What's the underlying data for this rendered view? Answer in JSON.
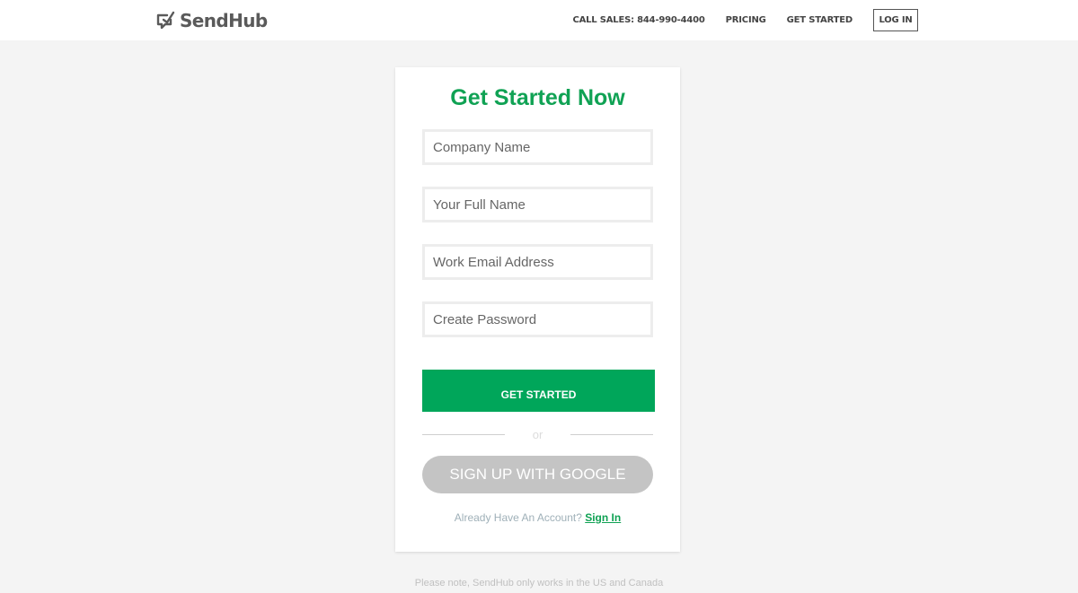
{
  "brand": {
    "name": "SendHub",
    "logo_icon": "chat-bubble-check-icon",
    "text_color": "#5a5a5a"
  },
  "nav": {
    "call_sales": "CALL SALES: 844-990-4400",
    "pricing": "PRICING",
    "get_started": "GET STARTED",
    "login": "LOG IN"
  },
  "signup": {
    "title": "Get Started Now",
    "company_placeholder": "Company Name",
    "name_placeholder": "Your Full Name",
    "email_placeholder": "Work Email Address",
    "password_placeholder": "Create Password",
    "submit_label": "GET STARTED",
    "divider_text": "or",
    "google_label": "SIGN UP WITH GOOGLE",
    "account_prompt": "Already Have An Account?",
    "signin_link": "Sign In"
  },
  "footer": {
    "note": "Please note, SendHub only works in the US and Canada"
  },
  "colors": {
    "accent_green": "#00a65a",
    "title_green": "#10a254",
    "google_button": "#c4c4c4",
    "page_background": "#f4f4f4"
  }
}
